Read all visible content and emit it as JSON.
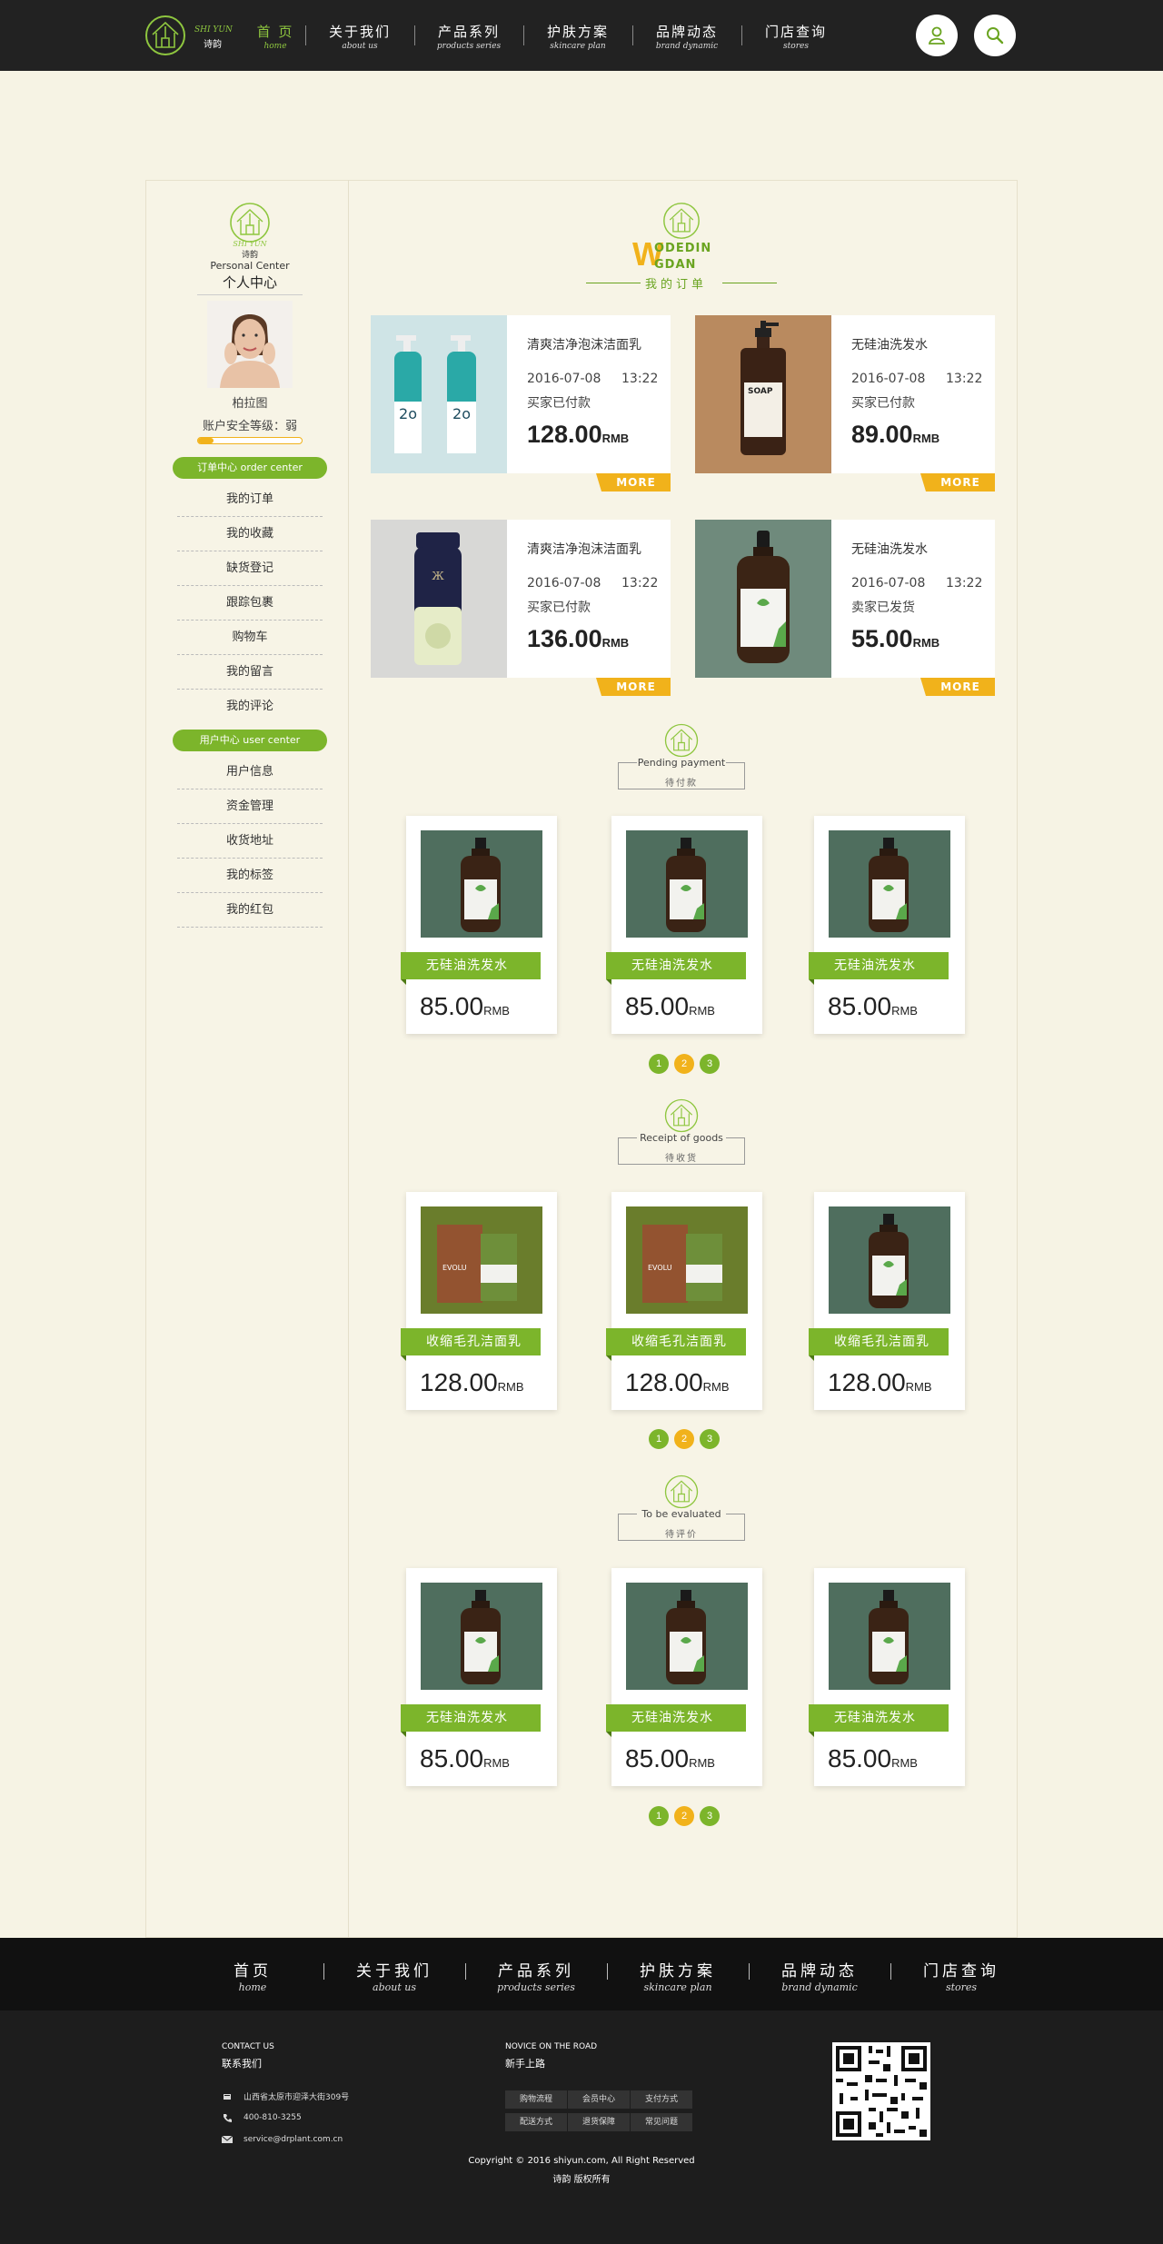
{
  "brand": {
    "en": "SHI YUN",
    "cn": "诗韵"
  },
  "nav": [
    {
      "cn": "首 页",
      "en": "home",
      "active": true
    },
    {
      "cn": "关于我们",
      "en": "about us",
      "active": false
    },
    {
      "cn": "产品系列",
      "en": "products series",
      "active": false
    },
    {
      "cn": "护肤方案",
      "en": "skincare plan",
      "active": false
    },
    {
      "cn": "品牌动态",
      "en": "brand dynamic",
      "active": false
    },
    {
      "cn": "门店查询",
      "en": "stores",
      "active": false
    }
  ],
  "header_icons": [
    "user-icon",
    "search-icon"
  ],
  "sidebar": {
    "logo_en": "SHI YUN",
    "logo_cn": "诗韵",
    "title_en": "Personal Center",
    "title_cn": "个人中心",
    "username": "柏拉图",
    "security_text": "账户安全等级：弱",
    "security_level": 0.15,
    "order_center": "订单中心   order  center",
    "order_items": [
      "我的订单",
      "我的收藏",
      "缺货登记",
      "跟踪包裹",
      "购物车",
      "我的留言",
      "我的评论"
    ],
    "user_center": "用户中心   user  center",
    "user_items": [
      "用户信息",
      "资金管理",
      "收货地址",
      "我的标签",
      "我的红包"
    ]
  },
  "main_heading": {
    "w": "W",
    "line1": "ODEDIN",
    "line2": "GDAN",
    "cn": "我的订单"
  },
  "orders": [
    {
      "name": "清爽洁净泡沫洁面乳",
      "date": "2016-07-08",
      "time": "13:22",
      "status": "买家已付款",
      "price": "128.00",
      "unit": "RMB",
      "more": "MORE"
    },
    {
      "name": "无硅油洗发水",
      "date": "2016-07-08",
      "time": "13:22",
      "status": "买家已付款",
      "price": "89.00",
      "unit": "RMB",
      "more": "MORE"
    },
    {
      "name": "清爽洁净泡沫洁面乳",
      "date": "2016-07-08",
      "time": "13:22",
      "status": "买家已付款",
      "price": "136.00",
      "unit": "RMB",
      "more": "MORE"
    },
    {
      "name": "无硅油洗发水",
      "date": "2016-07-08",
      "time": "13:22",
      "status": "卖家已发货",
      "price": "55.00",
      "unit": "RMB",
      "more": "MORE"
    }
  ],
  "sections": [
    {
      "en": "Pending payment",
      "cn": "待付款",
      "items": [
        {
          "name": "无硅油洗发水",
          "price": "85.00",
          "unit": "RMB"
        },
        {
          "name": "无硅油洗发水",
          "price": "85.00",
          "unit": "RMB"
        },
        {
          "name": "无硅油洗发水",
          "price": "85.00",
          "unit": "RMB"
        }
      ],
      "pages": [
        "1",
        "2",
        "3"
      ]
    },
    {
      "en": "Receipt of goods",
      "cn": "待收货",
      "items": [
        {
          "name": "收缩毛孔洁面乳",
          "price": "128.00",
          "unit": "RMB"
        },
        {
          "name": "收缩毛孔洁面乳",
          "price": "128.00",
          "unit": "RMB"
        },
        {
          "name": "收缩毛孔洁面乳",
          "price": "128.00",
          "unit": "RMB"
        }
      ],
      "pages": [
        "1",
        "2",
        "3"
      ]
    },
    {
      "en": "To be evaluated",
      "cn": "待评价",
      "items": [
        {
          "name": "无硅油洗发水",
          "price": "85.00",
          "unit": "RMB"
        },
        {
          "name": "无硅油洗发水",
          "price": "85.00",
          "unit": "RMB"
        },
        {
          "name": "无硅油洗发水",
          "price": "85.00",
          "unit": "RMB"
        }
      ],
      "pages": [
        "1",
        "2",
        "3"
      ]
    }
  ],
  "footer_nav": [
    {
      "cn": "首页",
      "en": "home"
    },
    {
      "cn": "关于我们",
      "en": "about   us"
    },
    {
      "cn": "产品系列",
      "en": "products series"
    },
    {
      "cn": "护肤方案",
      "en": "skincare plan"
    },
    {
      "cn": "品牌动态",
      "en": "brand dynamic"
    },
    {
      "cn": "门店查询",
      "en": "stores"
    }
  ],
  "footer": {
    "contact_en": "CONTACT US",
    "contact_cn": "联系我们",
    "address": "山西省太原市迎泽大街309号",
    "phone": "400-810-3255",
    "email": "service@drplant.com.cn",
    "novice_en": "NOVICE ON THE ROAD",
    "novice_cn": "新手上路",
    "links": [
      "购物流程",
      "会员中心",
      "支付方式",
      "配送方式",
      "退货保障",
      "常见问题"
    ],
    "copyright_line1": "Copyright ©  2016   shiyun.com,  All Right Reserved",
    "copyright_line2": "诗韵 版权所有"
  },
  "colors": {
    "green": "#7cb52b",
    "yellow": "#f1b21b",
    "dark": "#222222",
    "background": "#f6f3e4"
  }
}
